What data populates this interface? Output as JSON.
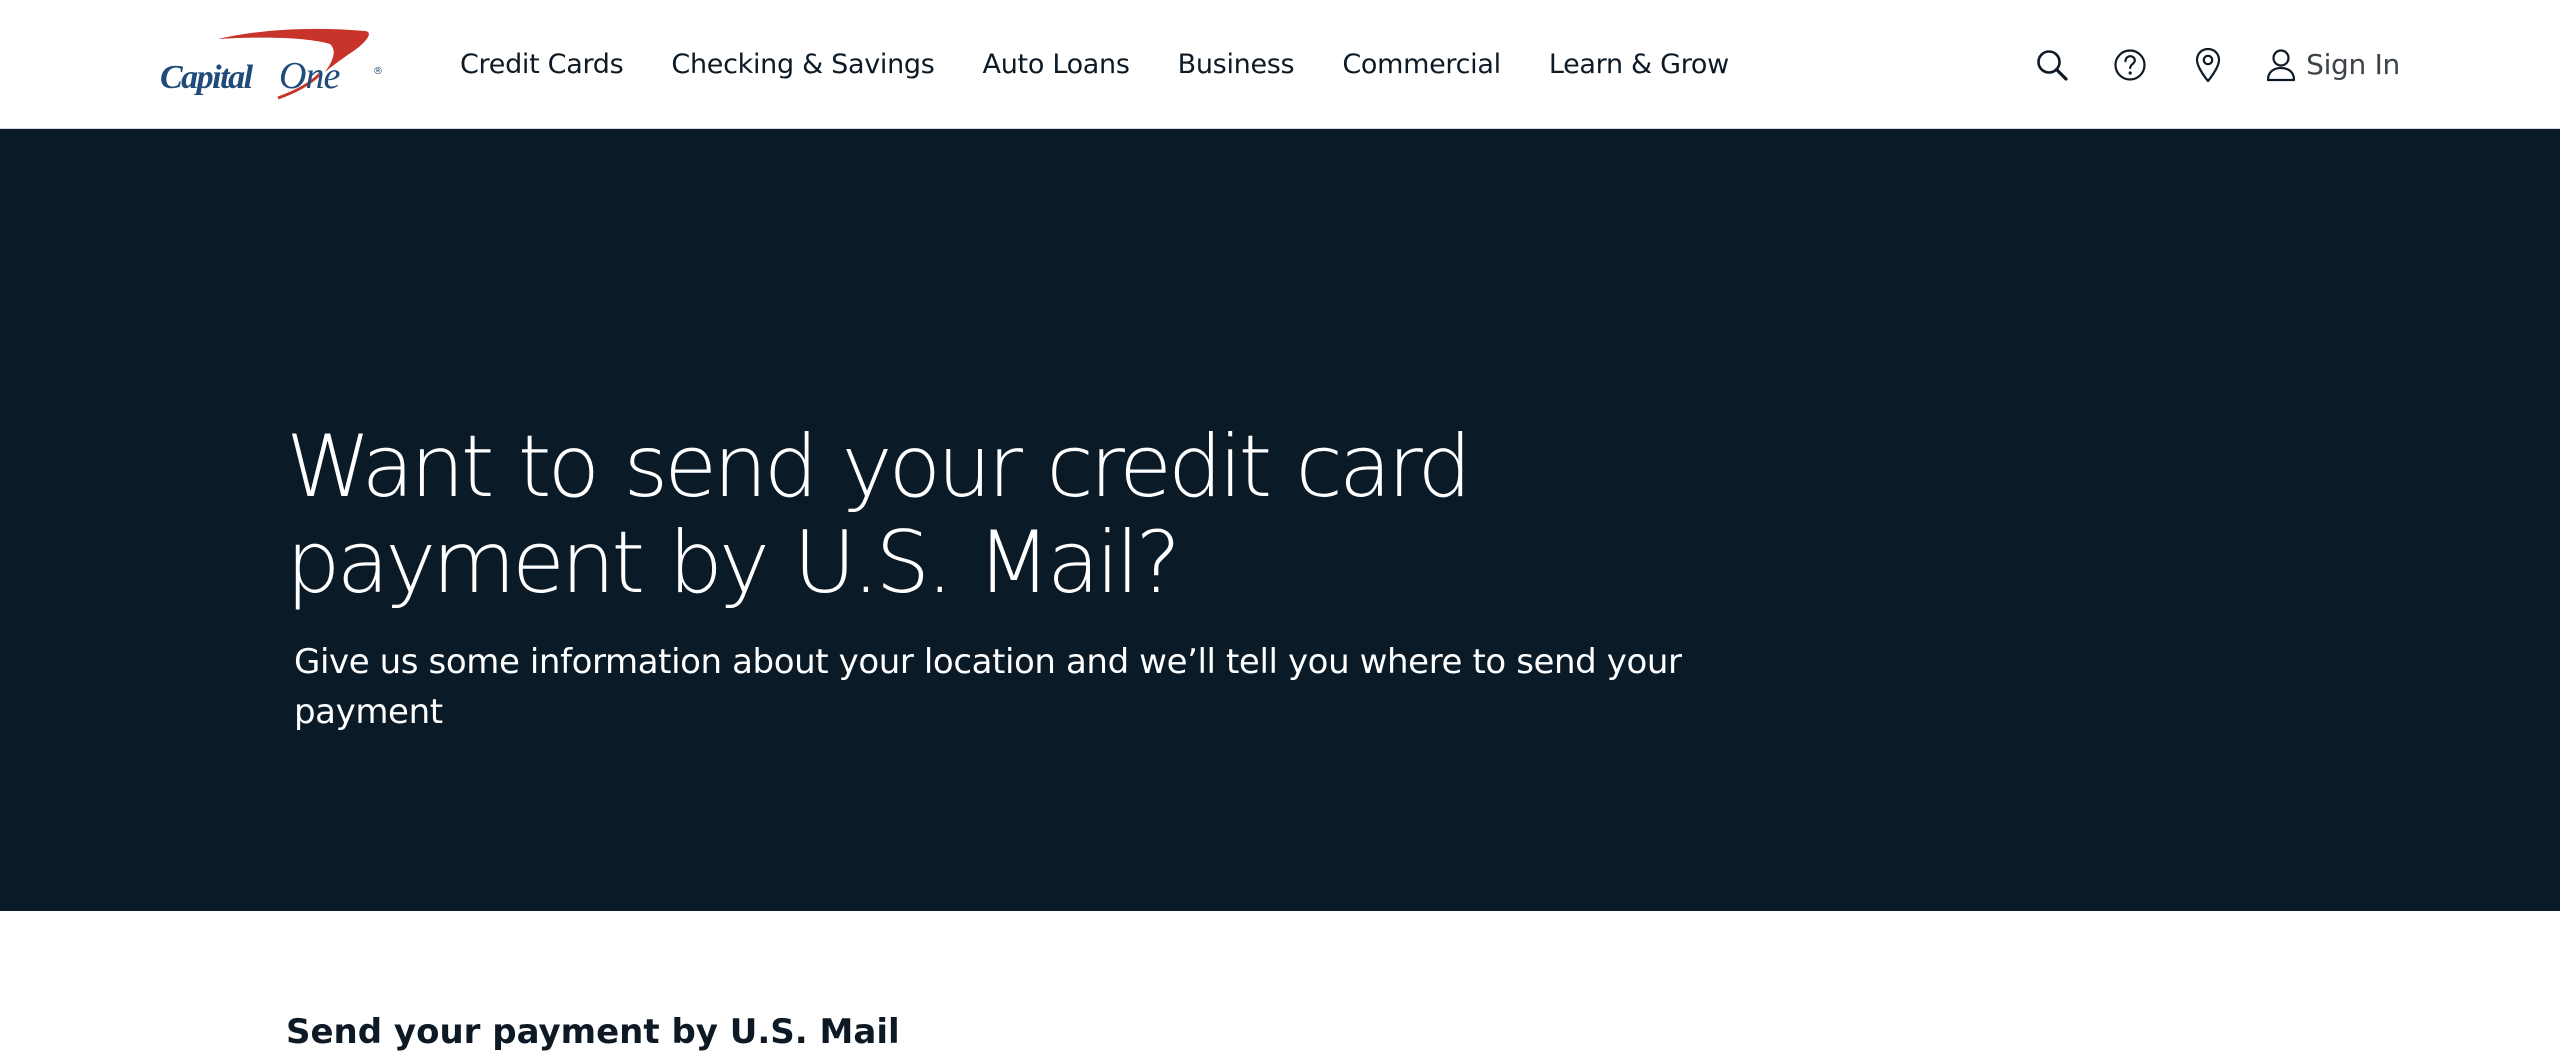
{
  "brand": {
    "name": "Capital One",
    "logo_text_capital": "Capital",
    "logo_text_one": "One",
    "logo_registered": "®",
    "logo_swoosh_color": "#c8342a",
    "logo_text_color": "#1f4b7a"
  },
  "nav": {
    "items": [
      {
        "label": "Credit Cards"
      },
      {
        "label": "Checking & Savings"
      },
      {
        "label": "Auto Loans"
      },
      {
        "label": "Business"
      },
      {
        "label": "Commercial"
      },
      {
        "label": "Learn & Grow"
      }
    ]
  },
  "utility": {
    "search_icon": "search-icon",
    "help_icon": "help-icon",
    "location_icon": "location-pin-icon",
    "user_icon": "user-icon",
    "sign_in_label": "Sign In"
  },
  "hero": {
    "title": "Want to send your credit card payment by U.S. Mail?",
    "subtitle": "Give us some information about your location and we’ll tell you where to send your payment",
    "background_color": "#0a1a27"
  },
  "section": {
    "heading": "Send your payment by U.S. Mail"
  }
}
